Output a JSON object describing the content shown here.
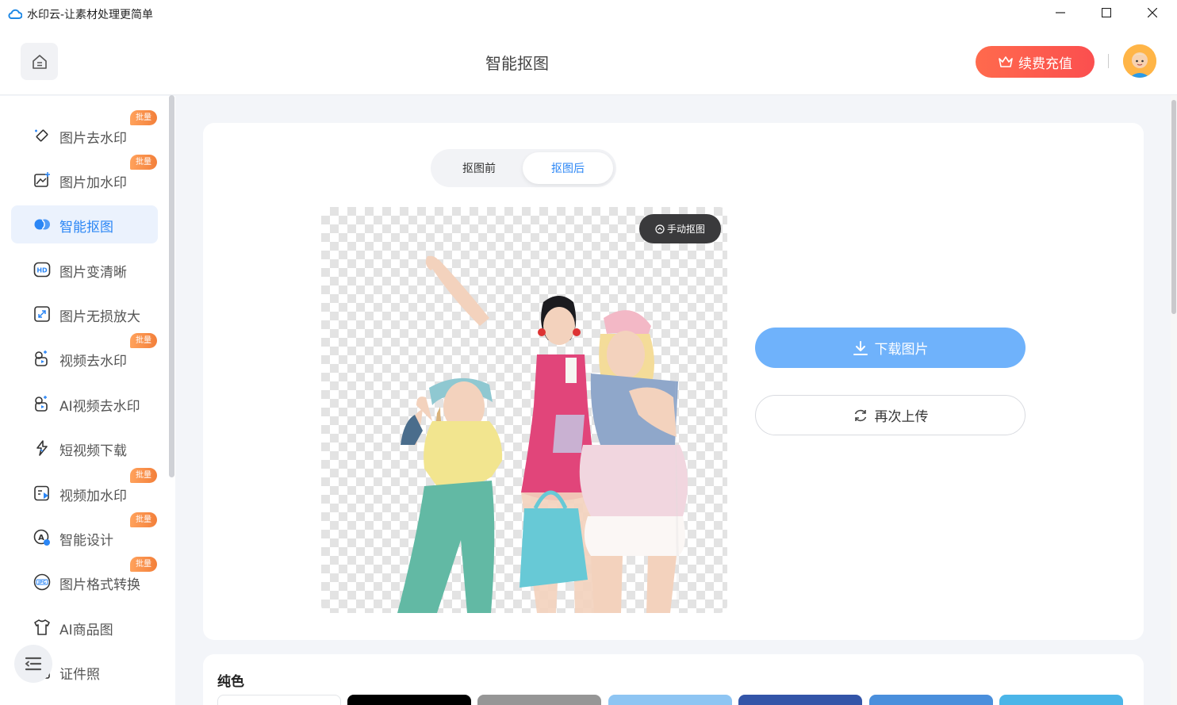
{
  "window": {
    "title": "水印云-让素材处理更简单",
    "controls": [
      "minimize",
      "maximize",
      "close"
    ]
  },
  "header": {
    "page_title": "智能抠图",
    "vip_label": "续费充值"
  },
  "sidebar": {
    "items": [
      {
        "label": "图片去水印",
        "icon": "eraser-icon",
        "badge": "批量",
        "active": false
      },
      {
        "label": "图片加水印",
        "icon": "image-plus-icon",
        "badge": "批量",
        "active": false
      },
      {
        "label": "智能抠图",
        "icon": "cutout-icon",
        "badge": "",
        "active": true
      },
      {
        "label": "图片变清晰",
        "icon": "hd-icon",
        "badge": "",
        "active": false
      },
      {
        "label": "图片无损放大",
        "icon": "expand-icon",
        "badge": "",
        "active": false
      },
      {
        "label": "视频去水印",
        "icon": "video-eraser-icon",
        "badge": "批量",
        "active": false
      },
      {
        "label": "AI视频去水印",
        "icon": "ai-video-icon",
        "badge": "",
        "active": false
      },
      {
        "label": "短视频下载",
        "icon": "download-link-icon",
        "badge": "",
        "active": false
      },
      {
        "label": "视频加水印",
        "icon": "video-plus-icon",
        "badge": "批量",
        "active": false
      },
      {
        "label": "智能设计",
        "icon": "design-icon",
        "badge": "批量",
        "active": false
      },
      {
        "label": "图片格式转换",
        "icon": "jpg-icon",
        "badge": "批量",
        "active": false
      },
      {
        "label": "AI商品图",
        "icon": "shirt-icon",
        "badge": "",
        "active": false
      },
      {
        "label": "证件照",
        "icon": "id-photo-icon",
        "badge": "",
        "active": false
      }
    ]
  },
  "main": {
    "segment": {
      "before": "抠图前",
      "after": "抠图后",
      "selected": "抠图后"
    },
    "manual_cutout_label": "手动抠图",
    "download_label": "下载图片",
    "reupload_label": "再次上传",
    "solid_section_title": "纯色",
    "swatches": [
      "#ffffff",
      "#000000",
      "#969696",
      "#8ec5f3",
      "#3355a8",
      "#4a8fdc",
      "#4bb5e8"
    ]
  },
  "colors": {
    "accent": "#2b86f5",
    "vip": "#fb5a4c",
    "badge": "#f58a44",
    "download": "#6fb2fb"
  }
}
